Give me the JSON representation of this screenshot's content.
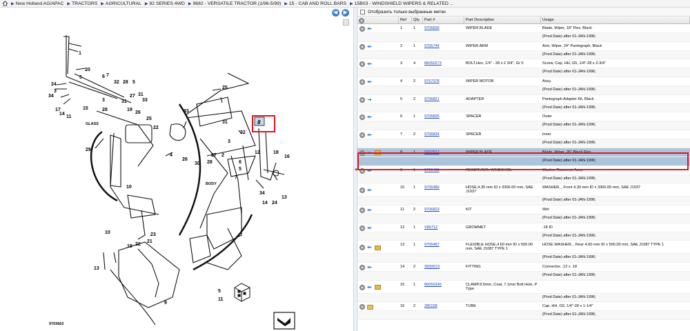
{
  "breadcrumb": [
    "New Holland AG/APAC",
    "TRACTORS",
    "AGRICULTURAL",
    "82 SERIES 4WD",
    "9682 - VERSATILE TRACTOR (1/96-5/99)",
    "15 - CAB AND ROLL BARS",
    "15B03 - WINDSHIELD WIPERS & RELATED ..."
  ],
  "filter": {
    "label": "Отобразить только выбранные метки"
  },
  "columns": [
    "Ref",
    "Qty",
    "Part #",
    "Part Description",
    "Usage"
  ],
  "diagram": {
    "code": "9703662",
    "glass_label": "GLASS",
    "body_label": "BODY",
    "callouts": [
      "1",
      "2",
      "3",
      "4",
      "5",
      "6",
      "7",
      "8",
      "9",
      "10",
      "11",
      "12",
      "13",
      "14",
      "15",
      "16",
      "17",
      "18",
      "19",
      "20",
      "21",
      "22",
      "23",
      "24",
      "25",
      "26",
      "27",
      "28",
      "29",
      "30",
      "31",
      "32",
      "33",
      "34"
    ]
  },
  "rows": [
    {
      "ref": "1",
      "qty": "1",
      "part": "9706836",
      "desc": "WIPER BLADE",
      "usage": "Blade, Wiper, 18\" Flex, Black",
      "sub": "(Prod Date) after 01-JAN-1996;",
      "icon": "blue"
    },
    {
      "ref": "2",
      "qty": "1",
      "part": "9705744",
      "desc": "WIPER ARM",
      "usage": "Arm, Wiper, 24\" Pantograph, Black",
      "sub": "(Prod Date) after 01-JAN-1996;",
      "icon": "blue"
    },
    {
      "ref": "3",
      "qty": "4",
      "part": "86050273",
      "desc": "BOLT,Hex, 1/4\" - 28 x 2 3/4\", Gr 5",
      "usage": "Screw, Cap, HH, G5, 1/4\"-28 x 2-3/4\"",
      "sub": "(Prod Date) after 01-JAN-1996;",
      "icon": "blue"
    },
    {
      "ref": "4",
      "qty": "2",
      "part": "9767078",
      "desc": "WIPER MOTOR",
      "usage": "Assy.",
      "sub": "(Prod Date) after 01-JAN-1996;",
      "icon": "blue"
    },
    {
      "ref": "5",
      "qty": "2",
      "part": "9706821",
      "desc": "ADAPTER",
      "usage": "Pantograph Adapter Kit, Black",
      "sub": "(Prod Date) after 01-JAN-1996;",
      "icon": "green"
    },
    {
      "ref": "6",
      "qty": "1",
      "part": "9706835",
      "desc": "SPACER",
      "usage": "Outer",
      "sub": "(Prod Date) after 01-JAN-1996;",
      "icon": "blue"
    },
    {
      "ref": "7",
      "qty": "2",
      "part": "9706834",
      "desc": "SPACER",
      "usage": "Inner",
      "sub": "(Prod Date) after 01-JAN-1996;",
      "icon": "blue"
    },
    {
      "ref": "8",
      "qty": "1",
      "part": "9707517",
      "desc": "WIPER BLADE",
      "usage": "Blade, Wiper, 26\" Black Flex",
      "sub": "(Prod Date) after 01-JAN-1996;",
      "icon": "blue-box",
      "selected": true
    },
    {
      "ref": "9",
      "qty": "1",
      "part": "9706485",
      "desc": "RESERVOIR, WINDSHIEL",
      "usage": "Washer Reservoir Assy.",
      "sub": "(Prod Date) after 01-JAN-1996;",
      "icon": "blue"
    },
    {
      "ref": "10",
      "qty": "1",
      "part": "9706486",
      "desc": "HOSE,4.30 mm ID x 3300.00 mm, SAE J1037",
      "usage": "WASHER, , Front 4.30 mm ID x 3300.00 mm, SAE J1037",
      "sub": "(Prod Date) after 01-JAN-1996;",
      "icon": "blue",
      "tall": true
    },
    {
      "ref": "11",
      "qty": "2",
      "part": "9706823",
      "desc": "KIT",
      "usage": "Wet",
      "sub": "(Prod Date) after 01-JAN-1996;",
      "icon": "blue"
    },
    {
      "ref": "12",
      "qty": "1",
      "part": "V86712",
      "desc": "GROMMET",
      "usage": ".18 ID",
      "sub": "(Prod Date) after 01-JAN-1996;",
      "icon": "blue"
    },
    {
      "ref": "13",
      "qty": "1",
      "part": "9706487",
      "desc": "FLEXIBLE HOSE,4.60 mm ID x 500.00 mm, SAE J1087 TYPE 1",
      "usage": "HOSE WASHER, , Rear 4.60 mm ID x 500.00 mm, SAE J1087 TYPE 1",
      "sub": "(Prod Date) after 01-JAN-1996;",
      "icon": "blue-box",
      "tall": true
    },
    {
      "ref": "14",
      "qty": "2",
      "part": "383001S",
      "desc": "FITTING",
      "usage": "Connector, .12 x .18",
      "sub": "(Prod Date) after 01-JAN-1996;",
      "icon": "blue"
    },
    {
      "ref": "15",
      "qty": "1",
      "part": "86050346",
      "desc": "CLAMP,9.5mm, Coat, 7.1mm Bolt Hole, P Type",
      "usage": "",
      "sub": "(Prod Date) after 01-JAN-1996;",
      "icon": "blue-box",
      "tall": true
    },
    {
      "ref": "16",
      "qty": "2",
      "part": "280158",
      "desc": "TUBE",
      "usage": "Cap, HH, G5, 1/4\"-28 x 1-1/4\"",
      "sub": "(Prod Date) after 01-JAN-1996;",
      "icon": "folder"
    }
  ]
}
